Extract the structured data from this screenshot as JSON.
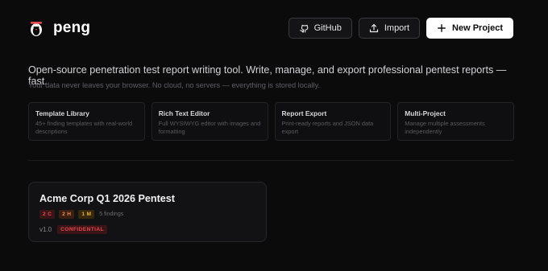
{
  "app": {
    "name": "peng",
    "logo_icon": "penguin-icon"
  },
  "header": {
    "github_label": "GitHub",
    "github_icon": "github-icon",
    "import_label": "Import",
    "import_icon": "upload-icon",
    "new_project_label": "New Project",
    "new_project_icon": "plus-icon"
  },
  "intro": {
    "tagline": "Open-source penetration test report writing tool. Write, manage, and export professional pentest reports — fast.",
    "note": "Your data never leaves your browser. No cloud, no servers — everything is stored locally."
  },
  "features": [
    {
      "title": "Template Library",
      "description": "45+ finding templates with real-world descriptions"
    },
    {
      "title": "Rich Text Editor",
      "description": "Full WYSIWYG editor with images and formatting"
    },
    {
      "title": "Report Export",
      "description": "Print-ready reports and JSON data export"
    },
    {
      "title": "Multi-Project",
      "description": "Manage multiple assessments independently"
    }
  ],
  "projects": [
    {
      "title": "Acme Corp Q1 2026 Pentest",
      "severity_counts": [
        {
          "label": "2 C",
          "color": "#e5484d",
          "bg": "#3a1416"
        },
        {
          "label": "2 H",
          "color": "#f2874a",
          "bg": "#3a2012"
        },
        {
          "label": "1 M",
          "color": "#e8b33c",
          "bg": "#38290c"
        }
      ],
      "findings_text": "5 findings",
      "version": "v1.0",
      "classification": "CONFIDENTIAL",
      "classification_color": "#e5484d",
      "classification_bg": "#3a1416"
    }
  ],
  "colors": {
    "background": "#0b0b0c",
    "card": "#121214",
    "primary_button": "#ffffff"
  }
}
